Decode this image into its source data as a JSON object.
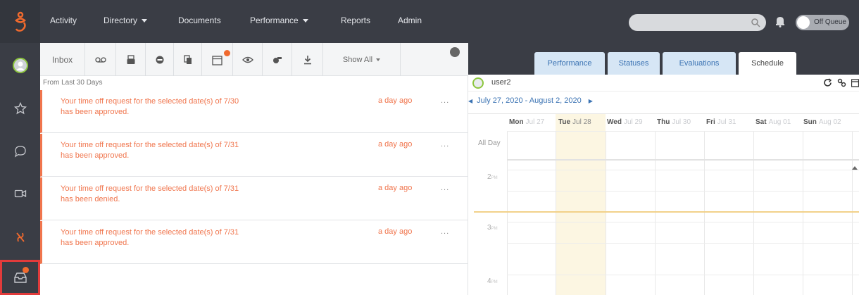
{
  "colors": {
    "nav_bg": "#3a3d45",
    "accent_orange": "#f0754d",
    "link_blue": "#3b73b3",
    "today_bg": "#fcf6e2",
    "presence_green": "#8dc63f",
    "notification_dot": "#f06a2e",
    "highlight_red": "#e23b3b"
  },
  "topnav": {
    "items": [
      {
        "label": "Activity"
      },
      {
        "label": "Directory",
        "dropdown": true
      },
      {
        "label": "Documents"
      },
      {
        "label": "Performance",
        "dropdown": true
      },
      {
        "label": "Reports"
      },
      {
        "label": "Admin"
      }
    ],
    "search_value": "",
    "queue_status": "Off Queue"
  },
  "rail": {
    "icons": [
      "avatar",
      "star-icon",
      "chat-icon",
      "video-icon",
      "genesys-icon",
      "inbox-icon"
    ]
  },
  "inbox": {
    "toolbar": {
      "inbox_label": "Inbox",
      "show_all": "Show All"
    },
    "range_label": "From Last 30 Days",
    "messages": [
      {
        "line1": "Your time off request for the selected date(s) of 7/30",
        "line2": "has been approved.",
        "time": "a day ago",
        "more": "..."
      },
      {
        "line1": "Your time off request for the selected date(s) of 7/31",
        "line2": "has been approved.",
        "time": "a day ago",
        "more": "..."
      },
      {
        "line1": "Your time off request for the selected date(s) of 7/31",
        "line2": "has been denied.",
        "time": "a day ago",
        "more": "..."
      },
      {
        "line1": "Your time off request for the selected date(s) of 7/31",
        "line2": "has been approved.",
        "time": "a day ago",
        "more": "..."
      }
    ]
  },
  "right": {
    "tabs": [
      "Performance",
      "Statuses",
      "Evaluations",
      "Schedule"
    ],
    "active_tab": "Schedule",
    "user": "user2",
    "date_range": "July 27, 2020 - August 2, 2020",
    "days": [
      {
        "day": "Mon",
        "date": "Jul 27"
      },
      {
        "day": "Tue",
        "date": "Jul 28",
        "today": true
      },
      {
        "day": "Wed",
        "date": "Jul 29"
      },
      {
        "day": "Thu",
        "date": "Jul 30"
      },
      {
        "day": "Fri",
        "date": "Jul 31"
      },
      {
        "day": "Sat",
        "date": "Aug 01"
      },
      {
        "day": "Sun",
        "date": "Aug 02"
      }
    ],
    "all_day_label": "All Day",
    "hours": [
      {
        "h": "2",
        "ampm": "PM"
      },
      {
        "h": "3",
        "ampm": "PM"
      },
      {
        "h": "4",
        "ampm": "PM"
      }
    ]
  }
}
